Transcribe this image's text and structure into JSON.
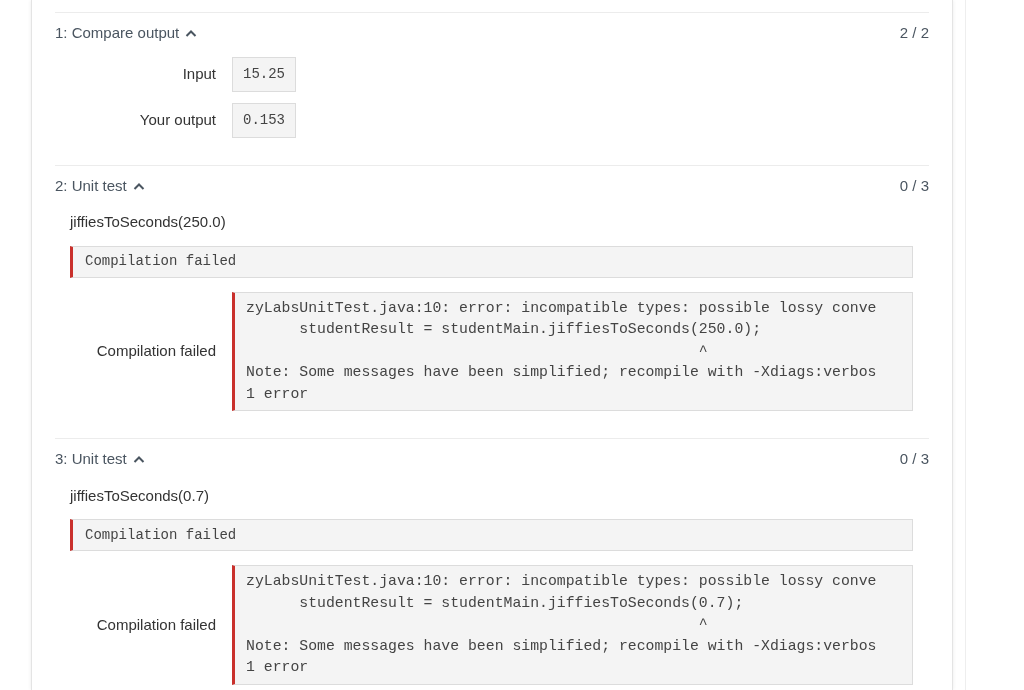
{
  "tests": [
    {
      "kind": "compare",
      "title": "1: Compare output",
      "expanded": true,
      "score": "2 / 2",
      "rows": [
        {
          "label": "Input",
          "value": "15.25"
        },
        {
          "label": "Your output",
          "value": "0.153"
        }
      ]
    },
    {
      "kind": "unit",
      "title": "2: Unit test",
      "expanded": true,
      "score": "0 / 3",
      "call": "jiffiesToSeconds(250.0)",
      "status": "Compilation failed",
      "detail_label": "Compilation failed",
      "detail_lines": [
        "zyLabsUnitTest.java:10: error: incompatible types: possible lossy conve",
        "      studentResult = studentMain.jiffiesToSeconds(250.0);",
        "                                                   ^",
        "Note: Some messages have been simplified; recompile with -Xdiags:verbos",
        "1 error"
      ]
    },
    {
      "kind": "unit",
      "title": "3: Unit test",
      "expanded": true,
      "score": "0 / 3",
      "call": "jiffiesToSeconds(0.7)",
      "status": "Compilation failed",
      "detail_label": "Compilation failed",
      "detail_lines": [
        "zyLabsUnitTest.java:10: error: incompatible types: possible lossy conve",
        "      studentResult = studentMain.jiffiesToSeconds(0.7);",
        "                                                   ^",
        "Note: Some messages have been simplified; recompile with -Xdiags:verbos",
        "1 error"
      ]
    }
  ]
}
